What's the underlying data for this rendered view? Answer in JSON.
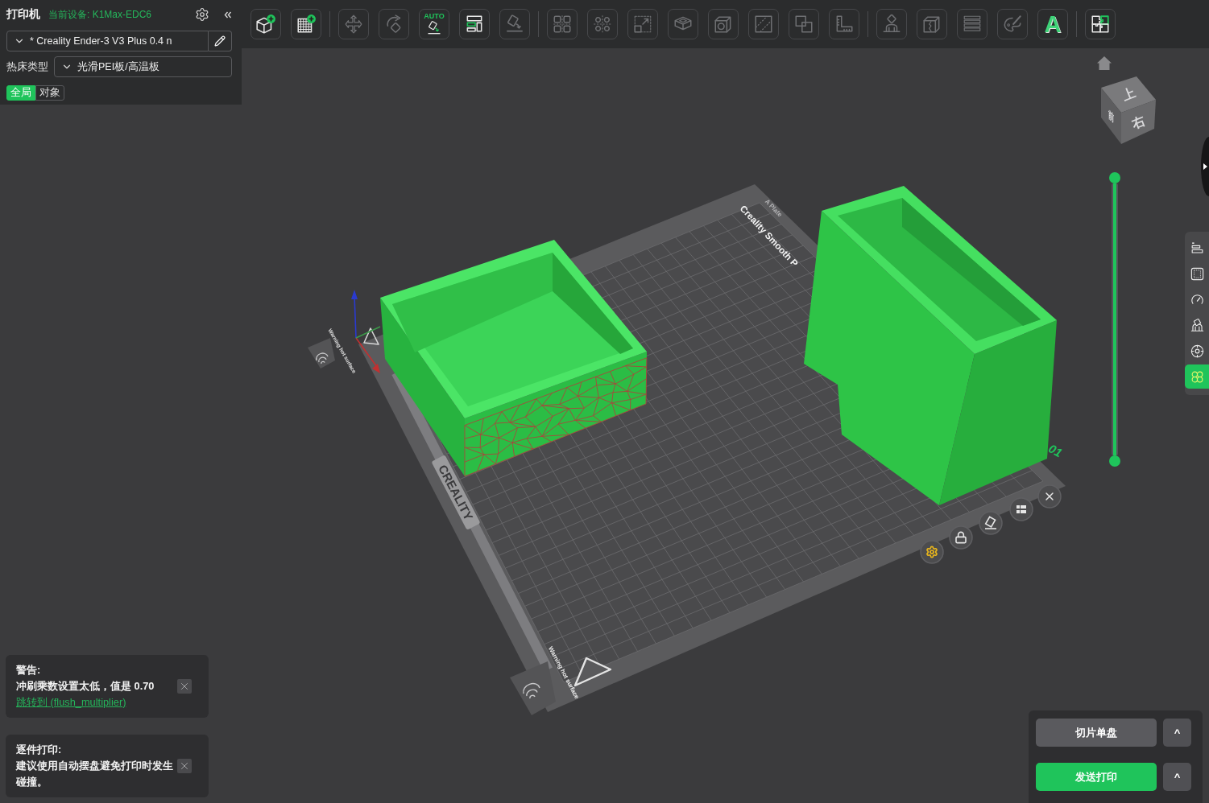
{
  "printer_panel": {
    "title": "打印机",
    "device": "当前设备: K1Max-EDC6",
    "printer_preset": "* Creality Ender-3 V3 Plus 0.4 n",
    "bed_label": "热床类型",
    "bed_type": "光滑PEI板/高温板",
    "scope_tabs": [
      {
        "label": "全局",
        "selected": true
      },
      {
        "label": "对象",
        "selected": false
      }
    ]
  },
  "toolbar": {
    "groups": [
      [
        {
          "disabled": false
        },
        {
          "disabled": false
        }
      ],
      [
        {
          "disabled": true
        },
        {
          "disabled": true
        },
        {
          "disabled": false,
          "badge": "AUTO"
        },
        {
          "disabled": false
        },
        {
          "disabled": true
        }
      ],
      [
        {
          "disabled": true
        },
        {
          "disabled": true
        },
        {
          "disabled": true
        },
        {
          "disabled": true
        },
        {
          "disabled": true
        },
        {
          "disabled": true
        },
        {
          "disabled": true
        },
        {
          "disabled": true
        }
      ],
      [
        {
          "disabled": true
        },
        {
          "disabled": true
        },
        {
          "disabled": true
        },
        {
          "disabled": true
        },
        {
          "disabled": false,
          "glyph": "A"
        }
      ],
      [
        {
          "disabled": false
        }
      ]
    ]
  },
  "viewport": {
    "view_cube": {
      "top": "上",
      "right": "右",
      "front": "前"
    },
    "plate_labels": [
      "A Plate",
      "Creality Smooth P",
      "CREALITY",
      "Warning hot surface",
      "Warning hot surface",
      "01"
    ],
    "layer_slider": {
      "level": 1
    }
  },
  "side_panel": {
    "items": [
      {
        "selected": false
      },
      {
        "selected": false
      },
      {
        "selected": false
      },
      {
        "selected": false
      },
      {
        "selected": false
      },
      {
        "selected": true
      }
    ]
  },
  "notifications": [
    {
      "title": "警告:",
      "message": "冲刷乘数设置太低，值是 0.70",
      "link": "跳转到 (flush_multiplier)"
    },
    {
      "title": "逐件打印:",
      "message": "建议使用自动摆盘避免打印时发生碰撞。"
    }
  ],
  "slice_panel": {
    "buttons": [
      {
        "kind": "secondary",
        "label": "切片单盘",
        "menu": "^"
      },
      {
        "kind": "primary",
        "label": "发送打印",
        "menu": "^"
      }
    ]
  }
}
